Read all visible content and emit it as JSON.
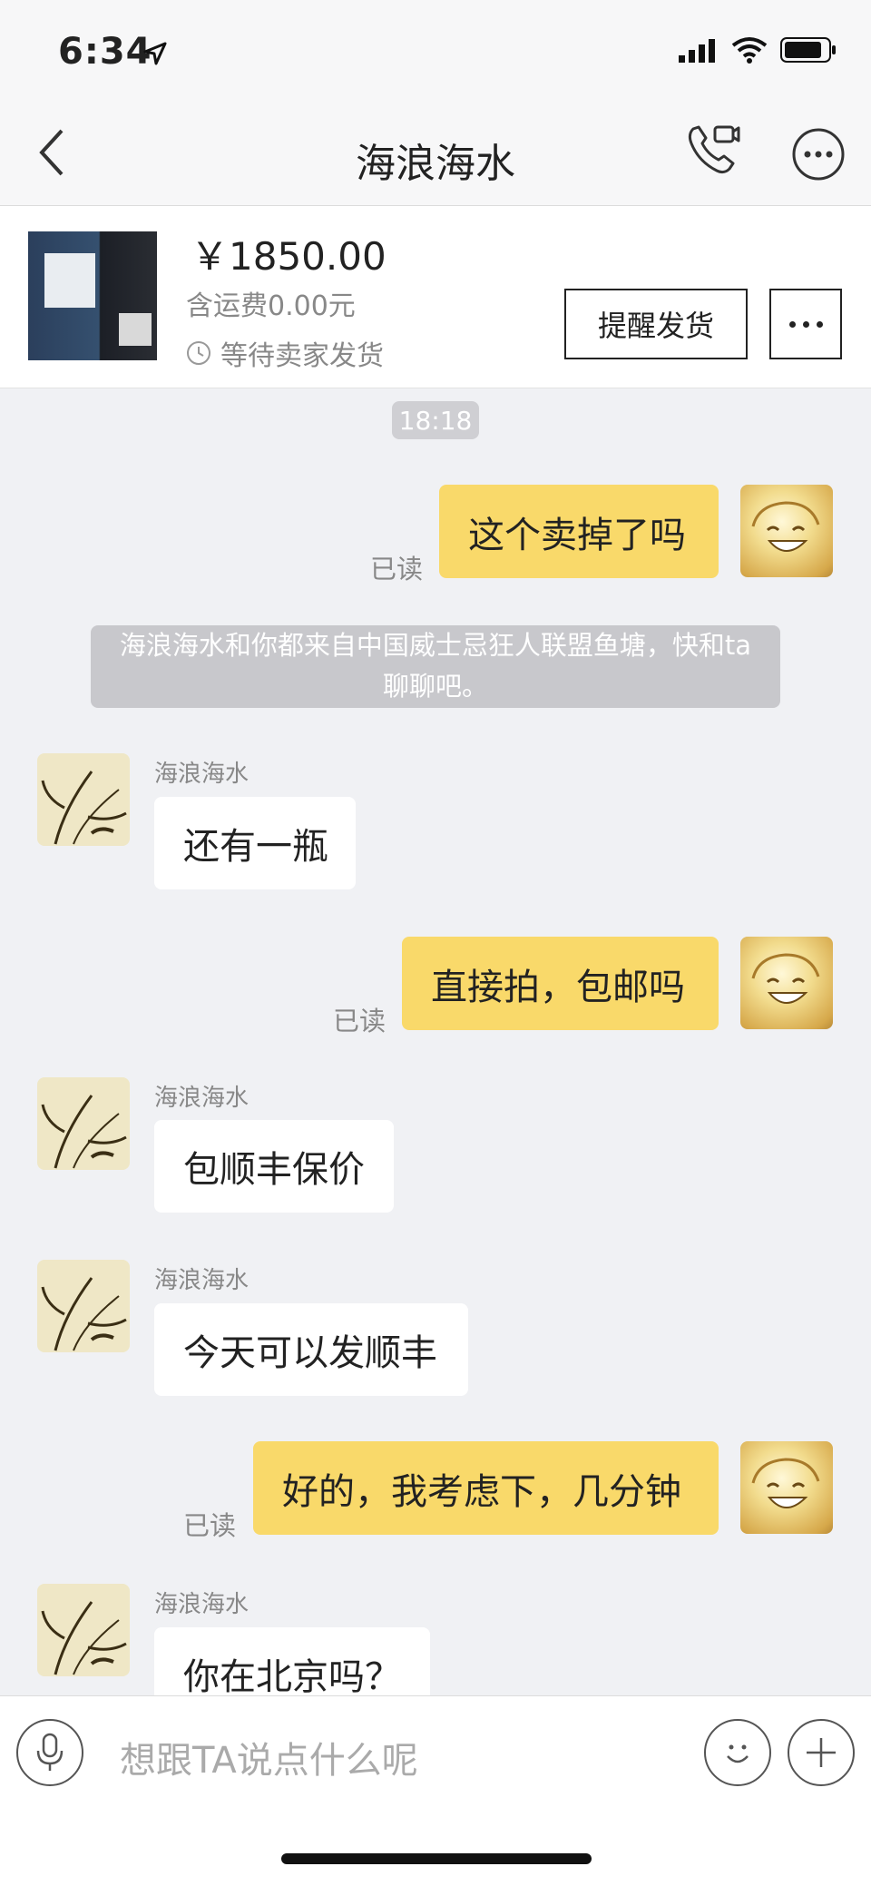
{
  "status_bar": {
    "time": "6:34",
    "icons": [
      "location-arrow-icon",
      "signal-icon",
      "wifi-icon",
      "battery-icon"
    ]
  },
  "nav": {
    "title": "海浪海水",
    "icons": [
      "back-chevron-icon",
      "video-call-icon",
      "more-circle-icon"
    ]
  },
  "product": {
    "price": "￥1850.00",
    "shipping": "含运费0.00元",
    "status": "等待卖家发货",
    "remind_button": "提醒发货"
  },
  "chat": {
    "timestamp": "18:18",
    "system_notice_line1": "海浪海水和你都来自中国威士忌狂人联盟鱼塘，快和ta",
    "system_notice_line2": "聊聊吧。",
    "messages": [
      {
        "from": "me",
        "text": "这个卖掉了吗",
        "status": "已读"
      },
      {
        "from": "them",
        "sender": "海浪海水",
        "text": "还有一瓶"
      },
      {
        "from": "me",
        "text": "直接拍，包邮吗",
        "status": "已读"
      },
      {
        "from": "them",
        "sender": "海浪海水",
        "text": "包顺丰保价"
      },
      {
        "from": "them",
        "sender": "海浪海水",
        "text": "今天可以发顺丰"
      },
      {
        "from": "me",
        "text": "好的，我考虑下，几分钟",
        "status": "已读"
      },
      {
        "from": "them",
        "sender": "海浪海水",
        "text": "你在北京吗？"
      }
    ]
  },
  "input": {
    "placeholder": "想跟TA说点什么呢"
  },
  "colors": {
    "my_bubble": "#f9d96a",
    "their_bubble": "#ffffff",
    "background": "#f0f1f4"
  }
}
